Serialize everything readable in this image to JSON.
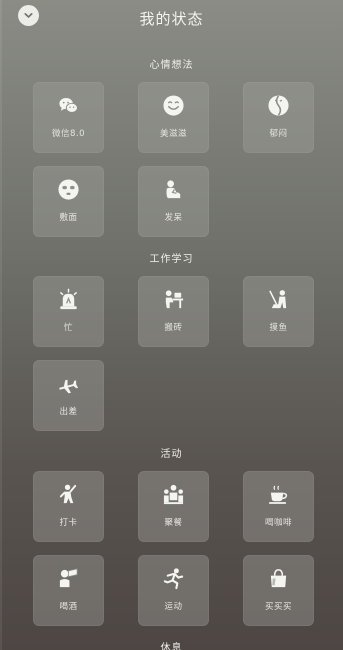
{
  "header": {
    "title": "我的状态",
    "back_icon": "chevron-down-icon"
  },
  "sections": [
    {
      "title": "心情想法",
      "items": [
        {
          "label": "微信8.0",
          "icon": "wechat-icon"
        },
        {
          "label": "美滋滋",
          "icon": "smile-icon"
        },
        {
          "label": "郁闷",
          "icon": "gloomy-icon"
        },
        {
          "label": "敷面",
          "icon": "face-mask-icon"
        },
        {
          "label": "发呆",
          "icon": "daze-icon"
        }
      ]
    },
    {
      "title": "工作学习",
      "items": [
        {
          "label": "忙",
          "icon": "alarm-light-icon"
        },
        {
          "label": "搬砖",
          "icon": "desk-work-icon"
        },
        {
          "label": "摸鱼",
          "icon": "sweeping-icon"
        },
        {
          "label": "出差",
          "icon": "airplane-icon"
        }
      ]
    },
    {
      "title": "活动",
      "items": [
        {
          "label": "打卡",
          "icon": "checkin-icon"
        },
        {
          "label": "聚餐",
          "icon": "gathering-icon"
        },
        {
          "label": "喝咖啡",
          "icon": "coffee-icon"
        },
        {
          "label": "喝酒",
          "icon": "drinking-icon"
        },
        {
          "label": "运动",
          "icon": "running-icon"
        },
        {
          "label": "买买买",
          "icon": "shopping-bag-icon"
        }
      ]
    },
    {
      "title": "休息",
      "items": []
    }
  ]
}
